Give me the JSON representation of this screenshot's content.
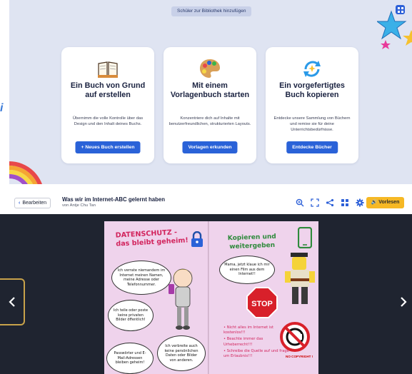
{
  "top_panel": {
    "add_student_label": "Schüler zur Bibliothek hinzufügen",
    "side_text": "i",
    "cards": [
      {
        "title": "Ein Buch von Grund auf erstellen",
        "description": "Übernimm die volle Kontrolle über das Design und den Inhalt deines Buchs.",
        "button_label": "+ Neues Buch erstellen",
        "icon": "open-book-icon"
      },
      {
        "title": "Mit einem Vorlagenbuch starten",
        "description": "Konzentriere dich auf Inhalte mit benutzerfreundlichen, strukturierten Layouts.",
        "button_label": "Vorlagen erkunden",
        "icon": "palette-icon"
      },
      {
        "title": "Ein vorgefertigtes Buch kopieren",
        "description": "Entdecke unsere Sammlung von Büchern und remixe sie für deine Unterrichtsbedürfnisse.",
        "button_label": "Entdecke Bücher",
        "icon": "sparkle-remix-icon"
      }
    ]
  },
  "book_header": {
    "back_label": "Bearbeiten",
    "title": "Was wir im Internet-ABC gelernt haben",
    "author": "von Antje Chu Tan",
    "read_label": "Vorlesen"
  },
  "viewer": {
    "left_page": {
      "title_line1": "DATENSCHUTZ -",
      "title_line2": "das bleibt geheim!",
      "clouds": [
        "Ich verrate niemandem im Internet meinen Namen, meine Adresse oder Telefonnummer.",
        "Ich teile oder poste keine privaten Bilder öffentlich!",
        "Passwörter und E-Mail-Adressen bleiben geheim!",
        "Ich verbreite auch keine persönlichen Daten oder Bilder von anderen."
      ]
    },
    "right_page": {
      "title_line1": "Kopieren und",
      "title_line2": "weitergeben",
      "speech": "Mama, jetzt klaue ich mir einen Film aus dem Internet!!",
      "stop_text": "STOP",
      "bullets": [
        "• Nicht alles im Internet ist kostenlos!!!",
        "• Beachte immer das Urheberrecht!!!",
        "• Schreibe die Quelle auf und frage um Erlaubnis!!!"
      ],
      "no_copyright_label": "NO COPYRIGHT !"
    }
  },
  "colors": {
    "accent_blue": "#2a62d8",
    "read_button": "#f6b824",
    "viewer_bg": "#1f2430",
    "page_pink": "#efd3ec"
  }
}
